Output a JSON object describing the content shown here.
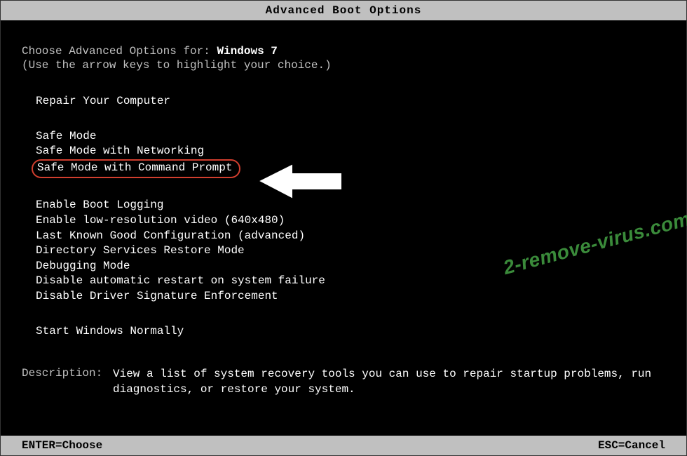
{
  "title": "Advanced Boot Options",
  "intro": {
    "prefix": "Choose Advanced Options for: ",
    "os_name": "Windows 7",
    "help": "(Use the arrow keys to highlight your choice.)"
  },
  "groups": [
    {
      "options": [
        {
          "label": "Repair Your Computer",
          "highlighted": false
        }
      ]
    },
    {
      "options": [
        {
          "label": "Safe Mode",
          "highlighted": false
        },
        {
          "label": "Safe Mode with Networking",
          "highlighted": false
        },
        {
          "label": "Safe Mode with Command Prompt",
          "highlighted": true
        }
      ]
    },
    {
      "options": [
        {
          "label": "Enable Boot Logging",
          "highlighted": false
        },
        {
          "label": "Enable low-resolution video (640x480)",
          "highlighted": false
        },
        {
          "label": "Last Known Good Configuration (advanced)",
          "highlighted": false
        },
        {
          "label": "Directory Services Restore Mode",
          "highlighted": false
        },
        {
          "label": "Debugging Mode",
          "highlighted": false
        },
        {
          "label": "Disable automatic restart on system failure",
          "highlighted": false
        },
        {
          "label": "Disable Driver Signature Enforcement",
          "highlighted": false
        }
      ]
    },
    {
      "options": [
        {
          "label": "Start Windows Normally",
          "highlighted": false
        }
      ]
    }
  ],
  "description": {
    "label": "Description:",
    "text": "View a list of system recovery tools you can use to repair startup problems, run diagnostics, or restore your system."
  },
  "footer": {
    "left": "ENTER=Choose",
    "right": "ESC=Cancel"
  },
  "watermark": "2-remove-virus.com"
}
